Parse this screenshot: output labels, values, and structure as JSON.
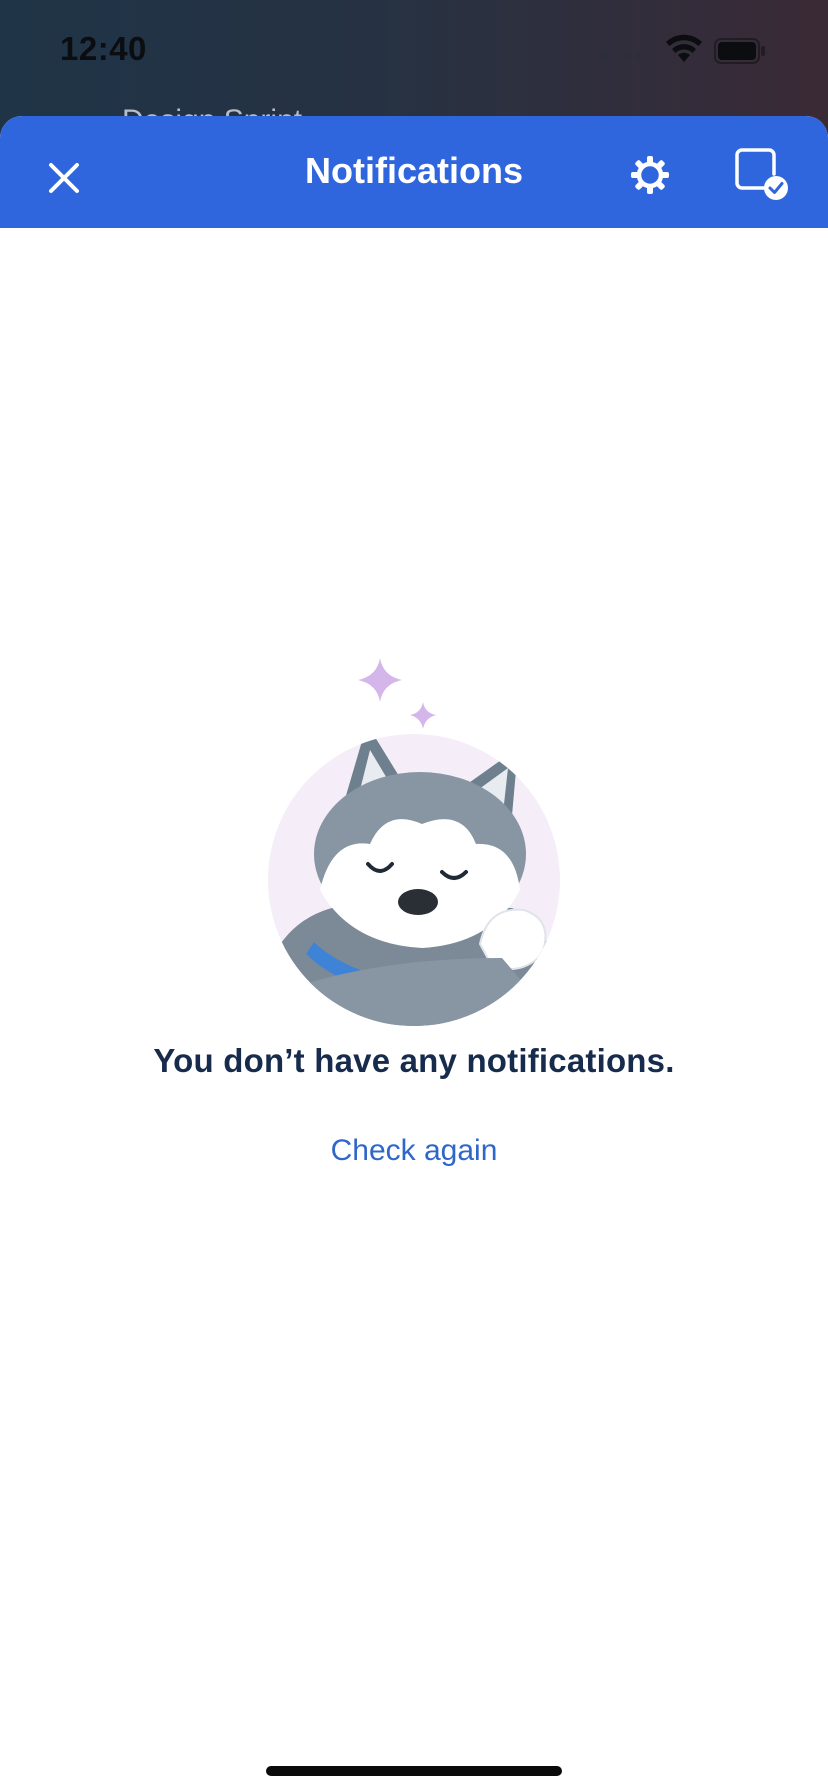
{
  "status_bar": {
    "time": "12:40",
    "icons": [
      "signal-icon",
      "wifi-icon",
      "battery-icon"
    ]
  },
  "background": {
    "partial_title": "Design Sprint"
  },
  "header": {
    "title": "Notifications",
    "close_icon": "close-icon",
    "settings_icon": "gear-icon",
    "mark_read_icon": "mark-all-read-icon",
    "background_color": "#2f66de"
  },
  "empty_state": {
    "illustration": "sleeping-husky-illustration",
    "message": "You don’t have any notifications.",
    "action_label": "Check again",
    "action_color": "#2f66c9"
  }
}
